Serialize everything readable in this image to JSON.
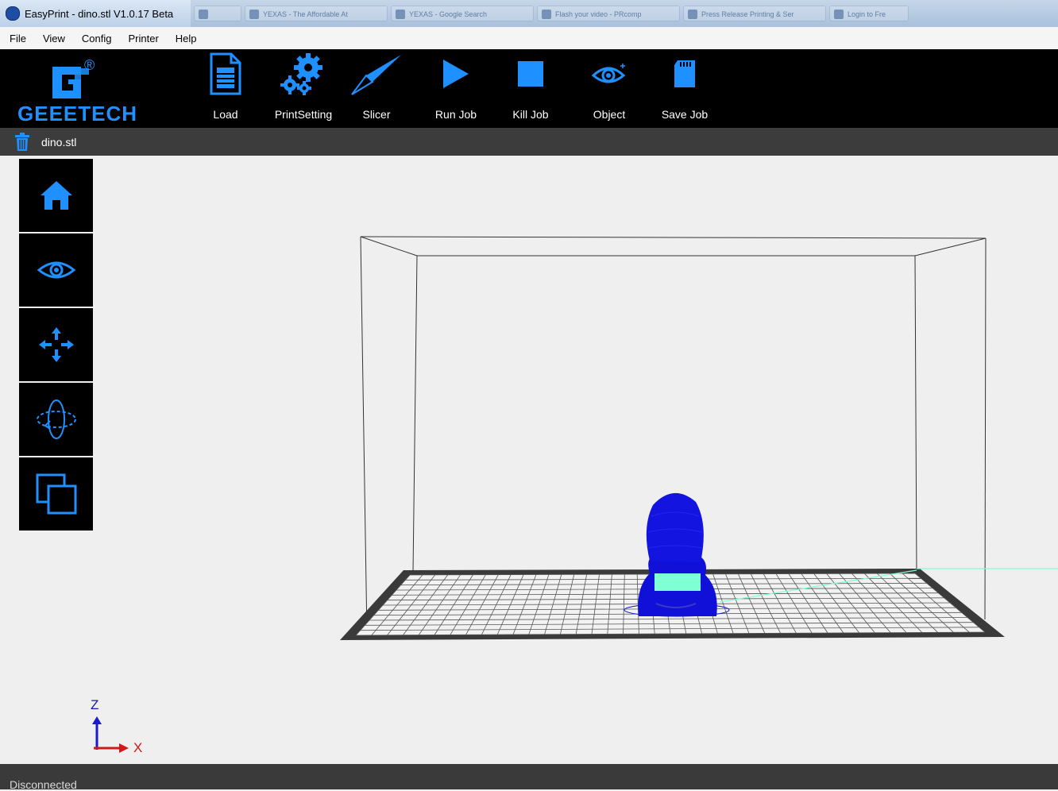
{
  "window": {
    "title": "EasyPrint - dino.stl   V1.0.17 Beta",
    "taskbar_items": [
      "",
      "YEXAS - The Affordable At",
      "YEXAS - Google Search",
      "Flash your video - PRcomp",
      "Press Release Printing & Ser",
      "Login to Fre"
    ]
  },
  "menu": {
    "items": [
      "File",
      "View",
      "Config",
      "Printer",
      "Help"
    ]
  },
  "brand": {
    "name": "GEEETECH",
    "reg": "®"
  },
  "toolbar": {
    "load": "Load",
    "print_setting": "PrintSetting",
    "slicer": "Slicer",
    "run_job": "Run Job",
    "kill_job": "Kill Job",
    "object": "Object",
    "save_job": "Save Job"
  },
  "file": {
    "name": "dino.stl"
  },
  "axes": {
    "z": "Z",
    "x": "X"
  },
  "status": {
    "text": "Disconnected"
  },
  "colors": {
    "accent": "#1e90ff",
    "model": "#1010d8",
    "model_highlight": "#7fffd4"
  }
}
